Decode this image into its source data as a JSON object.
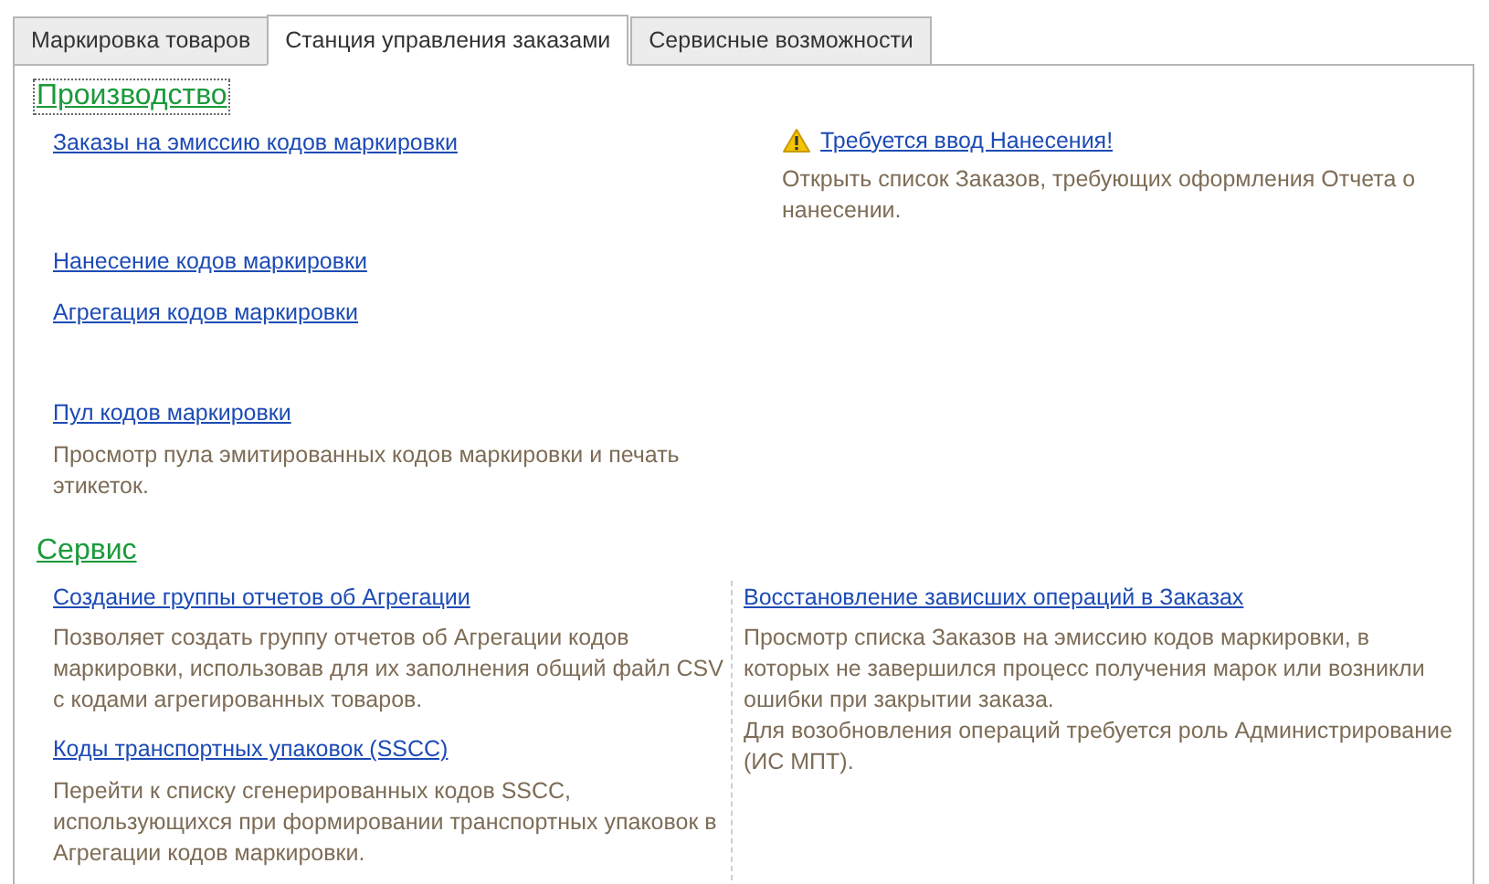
{
  "tabs": [
    {
      "label": "Маркировка товаров",
      "selected": false
    },
    {
      "label": "Станция управления заказами",
      "selected": true
    },
    {
      "label": "Сервисные возможности",
      "selected": false
    }
  ],
  "production": {
    "title": "Производство",
    "focused": true,
    "items": [
      {
        "link": "Заказы на эмиссию кодов маркировки"
      },
      {
        "link": "Нанесение кодов маркировки"
      },
      {
        "link": "Агрегация кодов маркировки"
      },
      {
        "link": "Пул кодов маркировки",
        "description": "Просмотр пула эмитированных кодов маркировки и печать этикеток."
      }
    ],
    "notice": {
      "kind": "warning",
      "link": "Требуется ввод Нанесения!",
      "description": "Открыть список Заказов, требующих оформления Отчета о нанесении."
    }
  },
  "service": {
    "title": "Сервис",
    "focused": false,
    "left": [
      {
        "link": "Создание группы отчетов об Агрегации",
        "description": "Позволяет создать группу отчетов об Агрегации кодов маркировки, использовав для их заполнения общий файл CSV с кодами агрегированных товаров."
      },
      {
        "link": "Коды транспортных упаковок (SSCC)",
        "description": "Перейти к списку сгенерированных кодов SSCC, использующихся при формировании транспортных упаковок в Агрегации кодов маркировки."
      }
    ],
    "right": [
      {
        "link": "Восстановление зависших операций в Заказах",
        "description": "Просмотр списка Заказов на эмиссию кодов маркировки, в которых не завершился процесс получения марок или возникли ошибки при закрытии заказа.\nДля возобновления операций требуется роль Администрирование (ИС МПТ)."
      }
    ]
  }
}
